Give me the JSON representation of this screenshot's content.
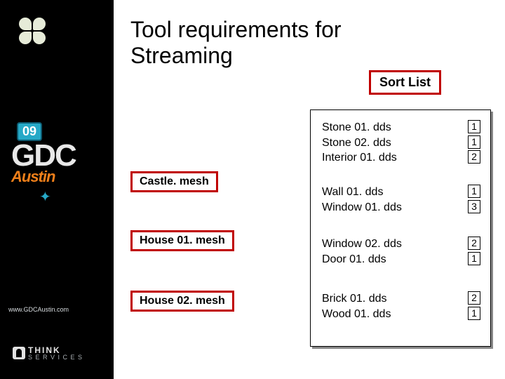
{
  "sidebar": {
    "badge_year": "09",
    "gdc": "GDC",
    "city": "Austin",
    "url": "www.GDCAustin.com",
    "think_top": "THINK",
    "think_bot": "S E R V I C E S"
  },
  "title_line1": "Tool requirements for",
  "title_line2": "Streaming",
  "sort_list_label": "Sort List",
  "meshes": {
    "castle": "Castle. mesh",
    "house1": "House 01. mesh",
    "house2": "House 02. mesh"
  },
  "dds": {
    "g1": {
      "names": [
        "Stone 01. dds",
        "Stone 02. dds",
        "Interior 01. dds"
      ],
      "nums": [
        "1",
        "1",
        "2"
      ]
    },
    "g2": {
      "names": [
        "Wall 01. dds",
        "Window 01. dds"
      ],
      "nums": [
        "1",
        "3"
      ]
    },
    "g3": {
      "names": [
        "Window 02. dds",
        "Door 01. dds"
      ],
      "nums": [
        "2",
        "1"
      ]
    },
    "g4": {
      "names": [
        "Brick 01. dds",
        "Wood 01. dds"
      ],
      "nums": [
        "2",
        "1"
      ]
    }
  }
}
